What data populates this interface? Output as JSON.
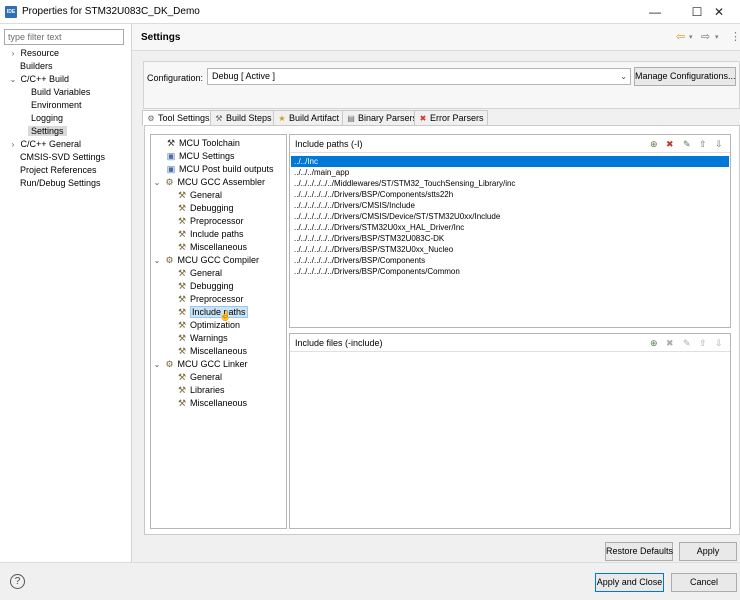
{
  "window": {
    "title": "Properties for STM32U083C_DK_Demo",
    "app_icon": "IDE",
    "buttons": {
      "minimize": "—",
      "maximize": "☐",
      "close": "✕"
    }
  },
  "left": {
    "filter_placeholder": "type filter text",
    "items": [
      {
        "label": "Resource",
        "arrow": ">"
      },
      {
        "label": "Builders",
        "arrow": ""
      },
      {
        "label": "C/C++ Build",
        "arrow": "v"
      },
      {
        "label": "Build Variables",
        "arrow": ""
      },
      {
        "label": "Environment",
        "arrow": ""
      },
      {
        "label": "Logging",
        "arrow": ""
      },
      {
        "label": "Settings",
        "arrow": ""
      },
      {
        "label": "C/C++ General",
        "arrow": ">"
      },
      {
        "label": "CMSIS-SVD Settings",
        "arrow": ""
      },
      {
        "label": "Project References",
        "arrow": ""
      },
      {
        "label": "Run/Debug Settings",
        "arrow": ""
      }
    ]
  },
  "settings": {
    "title": "Settings",
    "config_label": "Configuration:",
    "config_value": "Debug  [ Active ]",
    "manage_button": "Manage Configurations...",
    "nav_icons": [
      "back-arrow-icon",
      "forward-arrow-icon",
      "view-menu-icon"
    ]
  },
  "tabs": [
    {
      "label": "Tool Settings",
      "icon": "tool-settings-icon"
    },
    {
      "label": "Build Steps",
      "icon": "build-steps-icon"
    },
    {
      "label": "Build Artifact",
      "icon": "build-artifact-icon"
    },
    {
      "label": "Binary Parsers",
      "icon": "binary-parsers-icon"
    },
    {
      "label": "Error Parsers",
      "icon": "error-parsers-icon"
    }
  ],
  "tree": [
    {
      "label": "MCU Toolchain",
      "arrow": ""
    },
    {
      "label": "MCU Settings",
      "arrow": ""
    },
    {
      "label": "MCU Post build outputs",
      "arrow": ""
    },
    {
      "label": "MCU GCC Assembler",
      "arrow": "v"
    },
    {
      "label": "General",
      "arrow": ""
    },
    {
      "label": "Debugging",
      "arrow": ""
    },
    {
      "label": "Preprocessor",
      "arrow": ""
    },
    {
      "label": "Include paths",
      "arrow": ""
    },
    {
      "label": "Miscellaneous",
      "arrow": ""
    },
    {
      "label": "MCU GCC Compiler",
      "arrow": "v"
    },
    {
      "label": "General",
      "arrow": ""
    },
    {
      "label": "Debugging",
      "arrow": ""
    },
    {
      "label": "Preprocessor",
      "arrow": ""
    },
    {
      "label": "Include paths",
      "arrow": ""
    },
    {
      "label": "Optimization",
      "arrow": ""
    },
    {
      "label": "Warnings",
      "arrow": ""
    },
    {
      "label": "Miscellaneous",
      "arrow": ""
    },
    {
      "label": "MCU GCC Linker",
      "arrow": "v"
    },
    {
      "label": "General",
      "arrow": ""
    },
    {
      "label": "Libraries",
      "arrow": ""
    },
    {
      "label": "Miscellaneous",
      "arrow": ""
    }
  ],
  "include_paths": {
    "title": "Include paths (-I)",
    "rows": [
      "../../Inc",
      "../../../main_app",
      "../../../../../../Middlewares/ST/STM32_TouchSensing_Library/inc",
      "../../../../../../Drivers/BSP/Components/stts22h",
      "../../../../../../Drivers/CMSIS/Include",
      "../../../../../../Drivers/CMSIS/Device/ST/STM32U0xx/Include",
      "../../../../../../Drivers/STM32U0xx_HAL_Driver/Inc",
      "../../../../../../Drivers/BSP/STM32U083C-DK",
      "../../../../../../Drivers/BSP/STM32U0xx_Nucleo",
      "../../../../../../Drivers/BSP/Components",
      "../../../../../../Drivers/BSP/Components/Common"
    ]
  },
  "include_files": {
    "title": "Include files (-include)"
  },
  "buttons": {
    "restore": "Restore Defaults",
    "apply": "Apply",
    "apply_close": "Apply and Close",
    "cancel": "Cancel",
    "help": "?"
  }
}
